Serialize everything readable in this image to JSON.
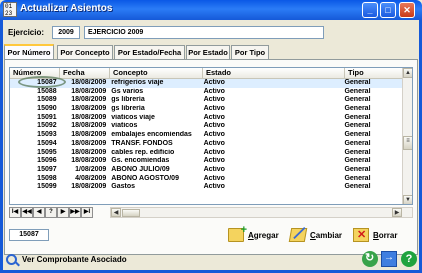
{
  "window": {
    "title": "Actualizar Asientos",
    "icon_text": "01\n23"
  },
  "ejercicio": {
    "label": "Ejercicio:",
    "year": "2009",
    "description": "EJERCICIO 2009"
  },
  "tabs": [
    {
      "label": "Por Número"
    },
    {
      "label": "Por Concepto"
    },
    {
      "label": "Por Estado/Fecha"
    },
    {
      "label": "Por Estado"
    },
    {
      "label": "Por Tipo"
    }
  ],
  "table": {
    "columns": [
      "Número",
      "Fecha",
      "Concepto",
      "Estado",
      "Tipo"
    ],
    "rows": [
      [
        "15087",
        "18/08/2009",
        "refrigerios viaje",
        "Activo",
        "General"
      ],
      [
        "15088",
        "18/08/2009",
        "Gs varios",
        "Activo",
        "General"
      ],
      [
        "15089",
        "18/08/2009",
        "gs librería",
        "Activo",
        "General"
      ],
      [
        "15090",
        "18/08/2009",
        "gs librería",
        "Activo",
        "General"
      ],
      [
        "15091",
        "18/08/2009",
        "viaticos viaje",
        "Activo",
        "General"
      ],
      [
        "15092",
        "18/08/2009",
        "viaticos",
        "Activo",
        "General"
      ],
      [
        "15093",
        "18/08/2009",
        "embalajes encomiendas",
        "Activo",
        "General"
      ],
      [
        "15094",
        "18/08/2009",
        "TRANSF. FONDOS",
        "Activo",
        "General"
      ],
      [
        "15095",
        "18/08/2009",
        "cables rep. edificio",
        "Activo",
        "General"
      ],
      [
        "15096",
        "18/08/2009",
        "Gs. encomiendas",
        "Activo",
        "General"
      ],
      [
        "15097",
        "1/08/2009",
        "ABONO JULIO/09",
        "Activo",
        "General"
      ],
      [
        "15098",
        "4/08/2009",
        "ABONO AGOSTO/09",
        "Activo",
        "General"
      ],
      [
        "15099",
        "18/08/2009",
        "Gastos",
        "Activo",
        "General"
      ]
    ]
  },
  "navigator": {
    "buttons": [
      "I◀",
      "◀◀",
      "◀",
      "?",
      "▶",
      "▶▶",
      "▶I"
    ]
  },
  "current_number": "15087",
  "actions": {
    "add": "Agregar",
    "edit": "Cambiar",
    "delete": "Borrar"
  },
  "footer": {
    "link": "Ver Comprobante Asociado"
  }
}
